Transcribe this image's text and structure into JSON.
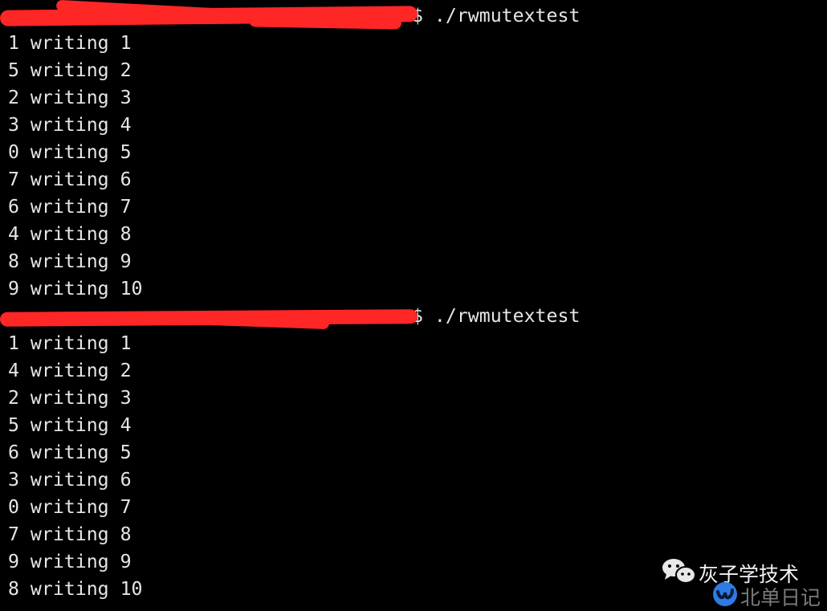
{
  "terminal": {
    "runs": [
      {
        "command": "$ ./rwmutextest",
        "output": [
          "1 writing 1",
          "5 writing 2",
          "2 writing 3",
          "3 writing 4",
          "0 writing 5",
          "7 writing 6",
          "6 writing 7",
          "4 writing 8",
          "8 writing 9",
          "9 writing 10"
        ]
      },
      {
        "command": "$ ./rwmutextest",
        "output": [
          "1 writing 1",
          "4 writing 2",
          "2 writing 3",
          "5 writing 4",
          "6 writing 5",
          "3 writing 6",
          "0 writing 7",
          "7 writing 8",
          "9 writing 9",
          "8 writing 10"
        ]
      }
    ],
    "redaction_color": "#ff2626",
    "text_color": "#e6e6e6",
    "background": "#000000"
  },
  "watermark": {
    "account": "灰子学技术",
    "account_icon": "wechat-icon",
    "platform": "北单日记",
    "platform_icon": "blue-circle-logo-icon",
    "platform_color": "#2f7be5"
  }
}
